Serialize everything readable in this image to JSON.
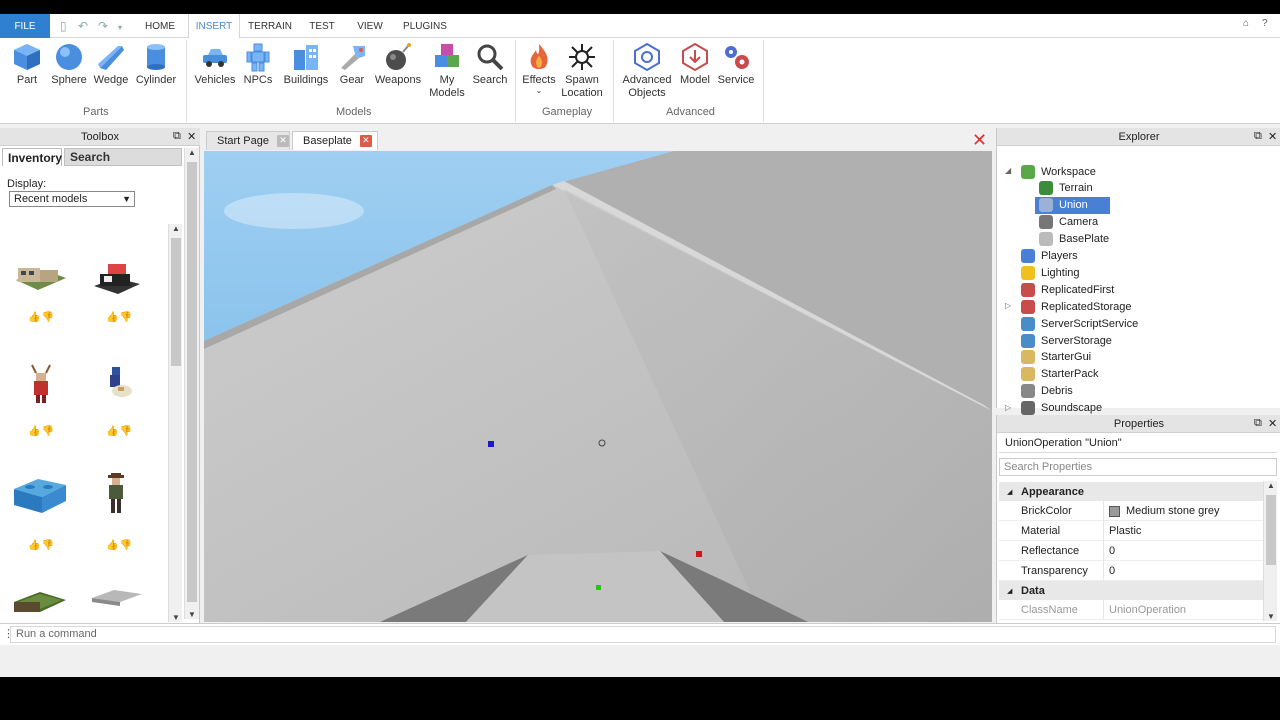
{
  "menubar": {
    "file": "FILE",
    "tabs": [
      {
        "label": "HOME",
        "active": false
      },
      {
        "label": "INSERT",
        "active": true
      },
      {
        "label": "TERRAIN",
        "active": false
      },
      {
        "label": "TEST",
        "active": false
      },
      {
        "label": "VIEW",
        "active": false
      },
      {
        "label": "PLUGINS",
        "active": false
      }
    ]
  },
  "ribbon": {
    "parts": {
      "group": "Parts",
      "items": [
        "Part",
        "Sphere",
        "Wedge",
        "Cylinder"
      ]
    },
    "models": {
      "group": "Models",
      "items": [
        "Vehicles",
        "NPCs",
        "Buildings",
        "Gear",
        "Weapons",
        "My Models",
        "Search"
      ]
    },
    "gameplay": {
      "group": "Gameplay",
      "items": [
        "Effects",
        "Spawn Location"
      ]
    },
    "advanced": {
      "group": "Advanced",
      "items": [
        "Advanced Objects",
        "Model",
        "Service"
      ]
    }
  },
  "toolbox": {
    "title": "Toolbox",
    "tabs": [
      "Inventory",
      "Search"
    ],
    "display_label": "Display:",
    "display_value": "Recent models"
  },
  "doctabs": {
    "items": [
      "Start Page",
      "Baseplate"
    ],
    "active": "Baseplate"
  },
  "explorer": {
    "title": "Explorer",
    "items": [
      {
        "label": "Workspace",
        "icon": "workspace-icon",
        "color": "#5aa84a"
      },
      {
        "label": "Terrain",
        "icon": "terrain-icon",
        "color": "#3c8c3c"
      },
      {
        "label": "Union",
        "icon": "union-icon",
        "color": "#9bb2d6",
        "selected": true
      },
      {
        "label": "Camera",
        "icon": "camera-icon",
        "color": "#777777"
      },
      {
        "label": "BasePlate",
        "icon": "part-icon",
        "color": "#bbbbbb"
      },
      {
        "label": "Players",
        "icon": "players-icon",
        "color": "#4a7fd6"
      },
      {
        "label": "Lighting",
        "icon": "lighting-icon",
        "color": "#f0c020"
      },
      {
        "label": "ReplicatedFirst",
        "icon": "replicated-first-icon",
        "color": "#c84c4c"
      },
      {
        "label": "ReplicatedStorage",
        "icon": "replicated-storage-icon",
        "color": "#c84c4c"
      },
      {
        "label": "ServerScriptService",
        "icon": "server-script-service-icon",
        "color": "#4a8cc8"
      },
      {
        "label": "ServerStorage",
        "icon": "server-storage-icon",
        "color": "#4a8cc8"
      },
      {
        "label": "StarterGui",
        "icon": "starter-gui-icon",
        "color": "#d8b860"
      },
      {
        "label": "StarterPack",
        "icon": "starter-pack-icon",
        "color": "#d8b860"
      },
      {
        "label": "Debris",
        "icon": "debris-icon",
        "color": "#888888"
      },
      {
        "label": "Soundscape",
        "icon": "soundscape-icon",
        "color": "#666666"
      }
    ]
  },
  "properties": {
    "title": "Properties",
    "header": "UnionOperation \"Union\"",
    "search_placeholder": "Search Properties",
    "categories": [
      {
        "name": "Appearance",
        "rows": [
          {
            "name": "BrickColor",
            "value": "Medium stone grey",
            "swatch": "#9a9a9a"
          },
          {
            "name": "Material",
            "value": "Plastic"
          },
          {
            "name": "Reflectance",
            "value": "0"
          },
          {
            "name": "Transparency",
            "value": "0"
          }
        ]
      },
      {
        "name": "Data",
        "rows": [
          {
            "name": "ClassName",
            "value": "UnionOperation",
            "muted": true
          }
        ]
      }
    ]
  },
  "command": {
    "placeholder": "Run a command"
  },
  "colors": {
    "accent": "#2f80d0",
    "selection": "#4a7fd6",
    "close": "#e05a48",
    "sky": "#8cc4ec"
  }
}
